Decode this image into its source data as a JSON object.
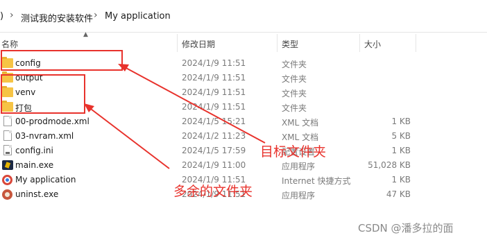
{
  "breadcrumb": {
    "partial": ")",
    "folder1": "测试我的安装软件",
    "folder2": "My application",
    "sep": "›"
  },
  "columns": {
    "name": "名称",
    "modified": "修改日期",
    "type": "类型",
    "size": "大小"
  },
  "files": [
    {
      "name": "config",
      "date": "2024/1/9 11:51",
      "type": "文件夹",
      "size": "",
      "icon": "folder-icon"
    },
    {
      "name": "output",
      "date": "2024/1/9 11:51",
      "type": "文件夹",
      "size": "",
      "icon": "folder-icon"
    },
    {
      "name": "venv",
      "date": "2024/1/9 11:51",
      "type": "文件夹",
      "size": "",
      "icon": "folder-icon"
    },
    {
      "name": "打包",
      "date": "2024/1/9 11:51",
      "type": "文件夹",
      "size": "",
      "icon": "folder-icon"
    },
    {
      "name": "00-prodmode.xml",
      "date": "2024/1/5 15:21",
      "type": "XML 文档",
      "size": "1 KB",
      "icon": "xml-file-icon"
    },
    {
      "name": "03-nvram.xml",
      "date": "2024/1/2 11:23",
      "type": "XML 文档",
      "size": "5 KB",
      "icon": "xml-file-icon"
    },
    {
      "name": "config.ini",
      "date": "2024/1/5 17:59",
      "type": "配置设置",
      "size": "1 KB",
      "icon": "ini-file-icon"
    },
    {
      "name": "main.exe",
      "date": "2024/1/9 11:00",
      "type": "应用程序",
      "size": "51,028 KB",
      "icon": "exe-icon"
    },
    {
      "name": "My application",
      "date": "2024/1/9 11:51",
      "type": "Internet 快捷方式",
      "size": "1 KB",
      "icon": "shortcut-icon"
    },
    {
      "name": "uninst.exe",
      "date": "2024/1/9 11:51",
      "type": "应用程序",
      "size": "47 KB",
      "icon": "uninstall-icon"
    }
  ],
  "annotations": {
    "target": "目标文件夹",
    "extra": "多余的文件夹"
  },
  "watermark": "CSDN @潘多拉的面",
  "colors": {
    "annotation": "#e8322c",
    "folder": "#f6c445"
  }
}
